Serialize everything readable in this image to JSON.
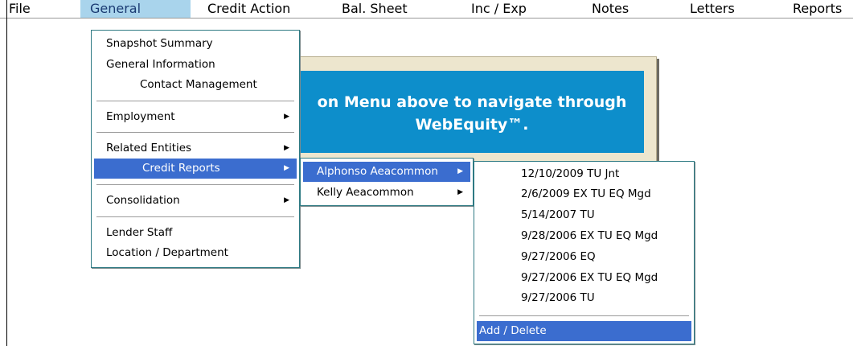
{
  "menubar": {
    "items": [
      "File",
      "General",
      "Credit Action",
      "Bal. Sheet",
      "Inc / Exp",
      "Notes",
      "Letters",
      "Reports"
    ],
    "active_index": 1
  },
  "banner": {
    "line1": "on Menu above to navigate through",
    "line2": "WebEquity™."
  },
  "general_menu": {
    "items": [
      {
        "label": "Snapshot Summary"
      },
      {
        "label": "General Information"
      },
      {
        "label": "Contact Management"
      },
      {
        "label": "Employment"
      },
      {
        "label": "Related Entities"
      },
      {
        "label": "Credit Reports"
      },
      {
        "label": "Consolidation"
      },
      {
        "label": "Lender Staff"
      },
      {
        "label": "Location / Department"
      }
    ]
  },
  "credit_reports_submenu": {
    "items": [
      {
        "label": "Alphonso Aeacommon"
      },
      {
        "label": "Kelly Aeacommon"
      }
    ]
  },
  "reports_list": {
    "items": [
      {
        "label": "12/10/2009 TU Jnt"
      },
      {
        "label": "2/6/2009 EX TU EQ Mgd"
      },
      {
        "label": "5/14/2007 TU"
      },
      {
        "label": "9/28/2006 EX TU EQ Mgd"
      },
      {
        "label": "9/27/2006 EQ"
      },
      {
        "label": "9/27/2006 EX TU EQ Mgd"
      },
      {
        "label": "9/27/2006 TU"
      }
    ],
    "action_label": "Add / Delete"
  },
  "icons": {
    "submenu_arrow": "chevron-right-icon"
  },
  "colors": {
    "highlight": "#3b6dcf",
    "active_menubar": "#a9d4ec",
    "banner": "#0d8ecb",
    "menu_border": "#2e7a83"
  }
}
